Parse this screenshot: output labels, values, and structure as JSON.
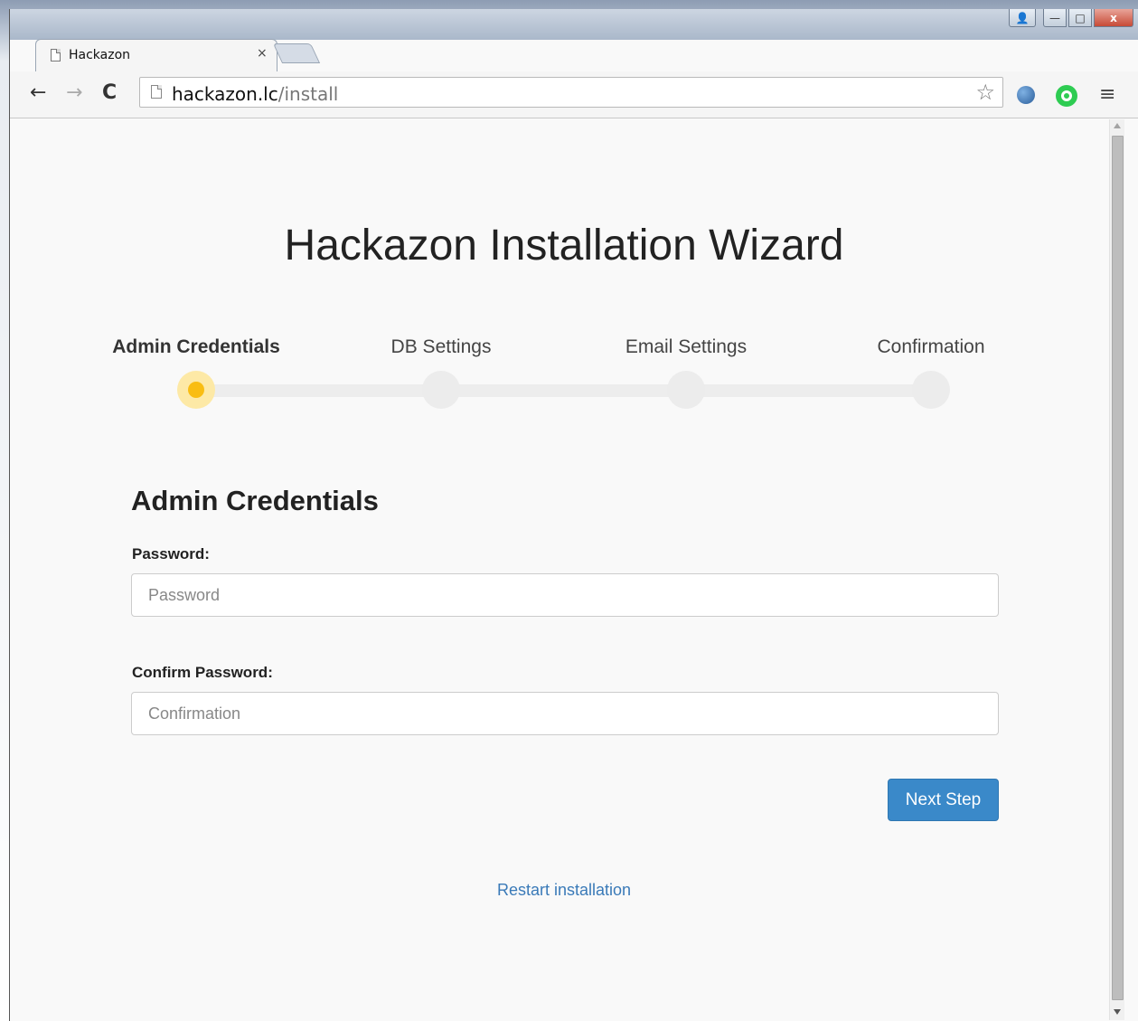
{
  "browser": {
    "tab": {
      "title": "Hackazon",
      "close_glyph": "×",
      "favicon": "page-icon"
    },
    "nav": {
      "back": "←",
      "forward": "→",
      "reload": "C"
    },
    "address": {
      "host": "hackazon.lc",
      "path": "/install"
    },
    "icons": [
      "star-icon",
      "globe-extension-icon",
      "green-extension-icon",
      "menu-icon"
    ],
    "window_controls": {
      "profile": "👤",
      "minimize": "—",
      "maximize": "□",
      "close": "x"
    }
  },
  "page": {
    "title": "Hackazon Installation Wizard",
    "steps": [
      {
        "label": "Admin Credentials",
        "active": true
      },
      {
        "label": "DB Settings",
        "active": false
      },
      {
        "label": "Email Settings",
        "active": false
      },
      {
        "label": "Confirmation",
        "active": false
      }
    ],
    "section_title": "Admin Credentials",
    "form": {
      "password_label": "Password:",
      "password_placeholder": "Password",
      "confirm_label": "Confirm Password:",
      "confirm_placeholder": "Confirmation",
      "next_button": "Next Step"
    },
    "restart_link": "Restart installation"
  },
  "colors": {
    "accent": "#3a89c9",
    "link": "#3a7ab8",
    "active_step": "#f9bd12",
    "active_step_halo": "#fde9a6",
    "inactive_step": "#ececec"
  }
}
